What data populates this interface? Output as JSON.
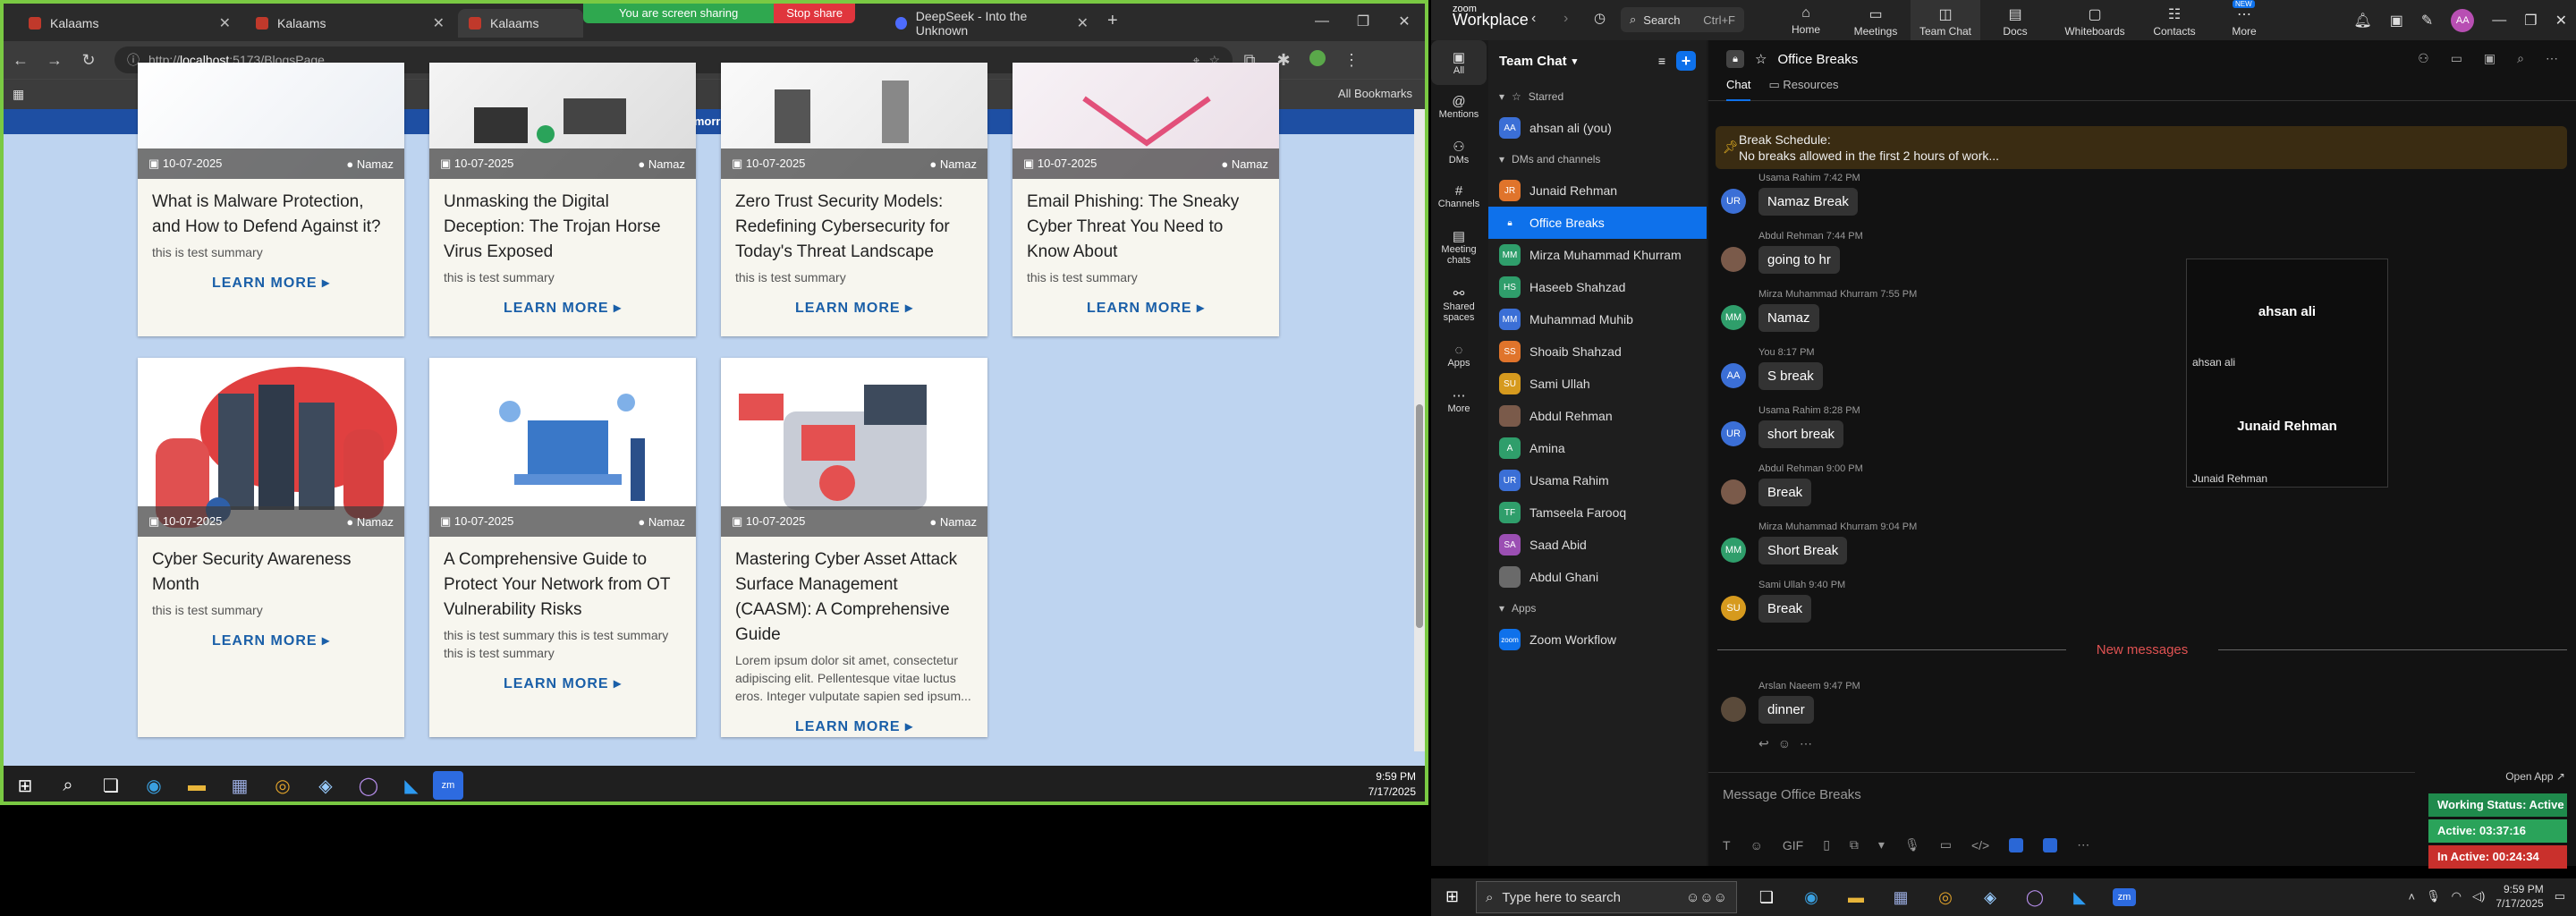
{
  "browser": {
    "tabs": [
      {
        "title": "Kalaams",
        "active": false
      },
      {
        "title": "Kalaams",
        "active": false
      },
      {
        "title": "Kalaams",
        "active": true
      },
      {
        "title": "DeepSeek - Into the Unknown",
        "active": false
      }
    ],
    "screen_sharing_text": "You are screen sharing",
    "stop_share_label": "Stop share",
    "url_prefix": "http://",
    "url_host": "localhost",
    "url_rest": ":5173/BlogsPage",
    "all_bookmarks": "All Bookmarks",
    "prayer_banner": "Next: Fajr (Tomorrow) at 3:49 AM",
    "clock_time": "9:59 PM",
    "clock_date": "7/17/2025"
  },
  "blog": {
    "learn_more": "LEARN MORE ▸",
    "cards": [
      {
        "date": "10-07-2025",
        "author": "Namaz",
        "title": "What is Malware Protection, and How to Defend Against it?",
        "summary": "this is test summary"
      },
      {
        "date": "10-07-2025",
        "author": "Namaz",
        "title": "Unmasking the Digital Deception: The Trojan Horse Virus Exposed",
        "summary": "this is test summary"
      },
      {
        "date": "10-07-2025",
        "author": "Namaz",
        "title": "Zero Trust Security Models: Redefining Cybersecurity for Today's Threat Landscape",
        "summary": "this is test summary"
      },
      {
        "date": "10-07-2025",
        "author": "Namaz",
        "title": "Email Phishing: The Sneaky Cyber Threat You Need to Know About",
        "summary": "this is test summary"
      },
      {
        "date": "10-07-2025",
        "author": "Namaz",
        "title": "Cyber Security Awareness Month",
        "summary": "this is test summary"
      },
      {
        "date": "10-07-2025",
        "author": "Namaz",
        "title": "A Comprehensive Guide to Protect Your Network from OT Vulnerability Risks",
        "summary": "this is test summary this is test summary this is test summary"
      },
      {
        "date": "10-07-2025",
        "author": "Namaz",
        "title": "Mastering Cyber Asset Attack Surface Management (CAASM): A Comprehensive Guide",
        "summary": "Lorem ipsum dolor sit amet, consectetur adipiscing elit. Pellentesque vitae luctus eros. Integer vulputate sapien sed ipsum..."
      }
    ]
  },
  "zoom": {
    "logo_top": "zoom",
    "logo_bottom": "Workplace",
    "search_label": "Search",
    "search_shortcut": "Ctrl+F",
    "nav": [
      "Home",
      "Meetings",
      "Team Chat",
      "Docs",
      "Whiteboards",
      "Contacts",
      "More"
    ],
    "more_badge": "NEW",
    "avatar_initials": "AA",
    "rail": [
      "All",
      "Mentions",
      "DMs",
      "Channels",
      "Meeting chats",
      "Shared spaces",
      "Apps",
      "More"
    ],
    "team_chat_title": "Team Chat",
    "starred_label": "Starred",
    "starred_item": "ahsan ali (you)",
    "dms_label": "DMs and channels",
    "contacts": [
      {
        "name": "Junaid Rehman",
        "initials": "JR",
        "color": "#e0742b"
      },
      {
        "name": "Office Breaks",
        "initials": "",
        "color": "#0e71eb"
      },
      {
        "name": "Mirza Muhammad Khurram",
        "initials": "MM",
        "color": "#2f9e6b"
      },
      {
        "name": "Haseeb Shahzad",
        "initials": "HS",
        "color": "#2f9e6b"
      },
      {
        "name": "Muhammad Muhib",
        "initials": "MM",
        "color": "#3b6fd6"
      },
      {
        "name": "Shoaib Shahzad",
        "initials": "SS",
        "color": "#e0742b"
      },
      {
        "name": "Sami Ullah",
        "initials": "SU",
        "color": "#d69a1e"
      },
      {
        "name": "Abdul Rehman",
        "initials": "",
        "color": "#7a5a4a"
      },
      {
        "name": "Amina",
        "initials": "A",
        "color": "#2f9e6b"
      },
      {
        "name": "Usama Rahim",
        "initials": "UR",
        "color": "#3b6fd6"
      },
      {
        "name": "Tamseela Farooq",
        "initials": "TF",
        "color": "#2f9e6b"
      },
      {
        "name": "Saad Abid",
        "initials": "SA",
        "color": "#9b4fb3"
      },
      {
        "name": "Abdul Ghani",
        "initials": "",
        "color": "#6a6a6a"
      }
    ],
    "apps_label": "Apps",
    "apps_item": "Zoom Workflow",
    "channel_name": "Office Breaks",
    "tab_chat": "Chat",
    "tab_resources": "Resources",
    "pinned_title": "Break Schedule:",
    "pinned_text": "No breaks allowed in the first 2 hours of work...",
    "messages": [
      {
        "author": "Usama Rahim 7:42 PM",
        "text": "Namaz Break",
        "initials": "UR",
        "color": "#3b6fd6"
      },
      {
        "author": "Abdul Rehman 7:44 PM",
        "text": "going to hr",
        "initials": "",
        "color": "#7a5a4a"
      },
      {
        "author": "Mirza Muhammad Khurram 7:55 PM",
        "text": "Namaz",
        "initials": "MM",
        "color": "#2f9e6b"
      },
      {
        "author": "You 8:17 PM",
        "text": "S break",
        "initials": "AA",
        "color": "#3b6fd6"
      },
      {
        "author": "Usama Rahim 8:28 PM",
        "text": "short break",
        "initials": "UR",
        "color": "#3b6fd6"
      },
      {
        "author": "Abdul Rehman 9:00 PM",
        "text": "Break",
        "initials": "",
        "color": "#7a5a4a"
      },
      {
        "author": "Mirza Muhammad Khurram 9:04 PM",
        "text": "Short Break",
        "initials": "MM",
        "color": "#2f9e6b"
      },
      {
        "author": "Sami Ullah 9:40 PM",
        "text": "Break",
        "initials": "SU",
        "color": "#d69a1e"
      }
    ],
    "new_messages": "New messages",
    "last_message": {
      "author": "Arslan Naeem 9:47 PM",
      "text": "dinner"
    },
    "video_tiles": [
      {
        "name": "ahsan ali",
        "label": "ahsan ali"
      },
      {
        "name": "Junaid Rehman",
        "label": "Junaid Rehman"
      }
    ],
    "compose_placeholder": "Message Office Breaks",
    "open_app": "Open App ↗",
    "status": [
      {
        "text": "Working Status: Active",
        "color": "#1f8a4c"
      },
      {
        "text": "Active: 03:37:16",
        "color": "#2aa35a"
      },
      {
        "text": "In Active: 00:24:34",
        "color": "#c9302c"
      }
    ]
  },
  "windows_taskbar": {
    "search_placeholder": "Type here to search",
    "time": "9:59 PM",
    "date": "7/17/2025"
  }
}
